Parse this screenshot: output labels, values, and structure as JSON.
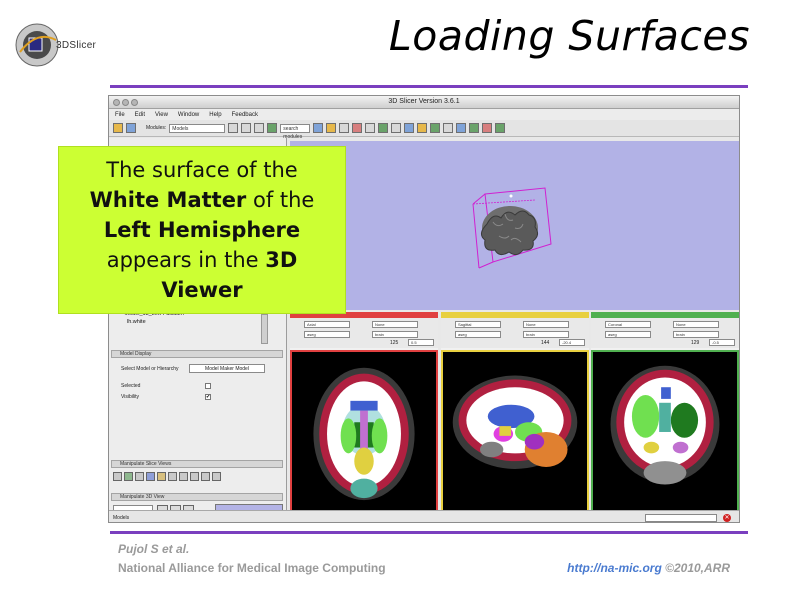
{
  "slide": {
    "logo_text": "3DSlicer",
    "title": "Loading Surfaces",
    "footer_author": "Pujol S et al.",
    "footer_org": "National Alliance for Medical Image Computing",
    "footer_url": "http://na-mic.org",
    "footer_copyright": " ©2010,ARR"
  },
  "window": {
    "title": "3D Slicer Version 3.6.1",
    "menu": [
      "File",
      "Edit",
      "View",
      "Window",
      "Help",
      "Feedback"
    ],
    "toolbar": {
      "modules_label": "Modules:",
      "module_value": "Models",
      "search_placeholder": "search modules"
    },
    "tree": {
      "model_item": "—Model_13_Left-Pallidum",
      "last_item": "lh.white"
    },
    "display": {
      "header": "Model Display",
      "select_label": "Select Model or Hierarchy",
      "select_value": "Model Maker Model",
      "selected_label": "Selected",
      "visibility_label": "Visibility",
      "visibility_checked": "✔"
    },
    "manipulate_slice_header": "Manipulate Slice Views",
    "manipulate_3d_header": "Manipulate 3D View",
    "status_text": "Models",
    "status_close": "✕"
  },
  "slices": [
    {
      "name": "Red",
      "orientation": "Axial",
      "fg": "None",
      "lb": "aseg",
      "bg": "brain",
      "offset": "125",
      "value": "0.5",
      "bar_color": "#e04040"
    },
    {
      "name": "Yellow",
      "orientation": "Sagittal",
      "fg": "None",
      "lb": "aseg",
      "bg": "brain",
      "offset": "144",
      "value": "-20.4",
      "bar_color": "#e8d040"
    },
    {
      "name": "Green",
      "orientation": "Coronal",
      "fg": "None",
      "lb": "aseg",
      "bg": "brain",
      "offset": "129",
      "value": "-0.5",
      "bar_color": "#50b050"
    }
  ],
  "callout": {
    "line1": "The surface of the",
    "bold1": "White Matter",
    "rest1": " of the",
    "bold2": "Left Hemisphere",
    "line4a": "appears in the ",
    "bold3": "3D",
    "bold4": "Viewer"
  },
  "colors": {
    "accent_rule": "#7a3fbf",
    "callout_bg": "#ccff33",
    "view3d_bg": "#b2b2e6",
    "bbox": "#d020d0"
  }
}
